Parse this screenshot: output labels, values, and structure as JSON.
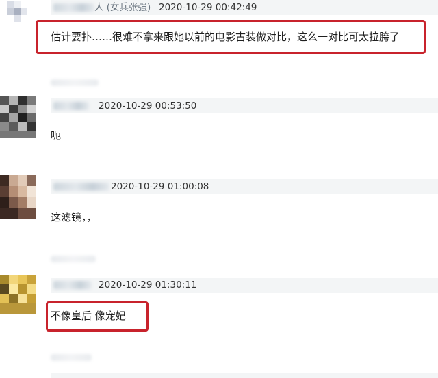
{
  "comments": [
    {
      "meta_suffix": "人 (女兵张强)",
      "timestamp": "2020-10-29 00:42:49",
      "text": "估计要扑……很难不拿来跟她以前的电影古装做对比，这么一对比可太拉胯了"
    },
    {
      "timestamp": "2020-10-29 00:53:50",
      "text": "呃"
    },
    {
      "timestamp": "2020-10-29 01:00:08",
      "text": "这滤镜，，"
    },
    {
      "timestamp": "2020-10-29 01:30:11",
      "text": "不像皇后 像宠妃"
    }
  ],
  "colors": {
    "highlight_border": "#c8232c",
    "meta_bar_bg": "#f3f5f6"
  }
}
